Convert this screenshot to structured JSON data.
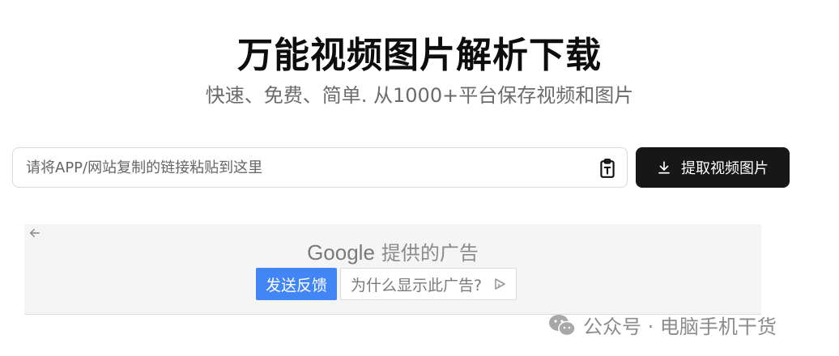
{
  "hero": {
    "title": "万能视频图片解析下载",
    "subtitle": "快速、免费、简单. 从1000+平台保存视频和图片"
  },
  "search": {
    "placeholder": "请将APP/网站复制的链接粘贴到这里",
    "value": "",
    "paste_icon": "clipboard-paste-icon",
    "submit_label": "提取视频图片",
    "submit_icon": "download-icon"
  },
  "ad": {
    "brand": "Google",
    "header_text": "提供的广告",
    "feedback_label": "发送反馈",
    "why_label": "为什么显示此广告?",
    "back_icon": "back-arrow-icon",
    "adchoices_icon": "adchoices-icon"
  },
  "watermark": {
    "text": "公众号 · 电脑手机干货",
    "icon": "wechat-icon"
  },
  "colors": {
    "submit_bg": "#171717",
    "feedback_bg": "#4285f4",
    "ad_bg": "#f5f5f5"
  }
}
